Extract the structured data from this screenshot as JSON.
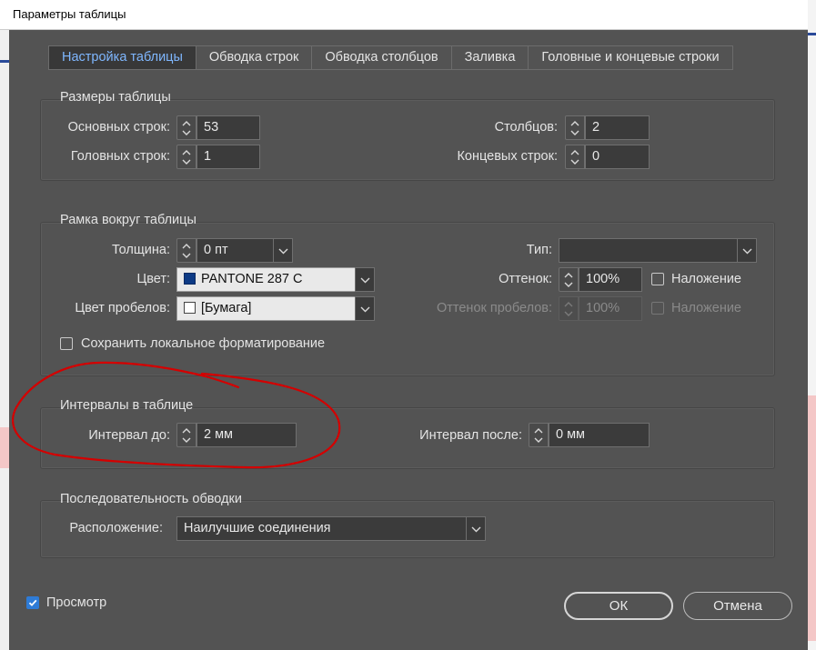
{
  "window": {
    "title": "Параметры таблицы"
  },
  "tabs": [
    {
      "label": "Настройка таблицы",
      "active": true
    },
    {
      "label": "Обводка строк"
    },
    {
      "label": "Обводка столбцов"
    },
    {
      "label": "Заливка"
    },
    {
      "label": "Головные и концевые строки"
    }
  ],
  "table_size": {
    "title": "Размеры таблицы",
    "body_rows_label": "Основных строк:",
    "body_rows": "53",
    "columns_label": "Столбцов:",
    "columns": "2",
    "header_rows_label": "Головных строк:",
    "header_rows": "1",
    "footer_rows_label": "Концевых строк:",
    "footer_rows": "0"
  },
  "border": {
    "title": "Рамка вокруг таблицы",
    "weight_label": "Толщина:",
    "weight": "0 пт",
    "type_label": "Тип:",
    "type": "",
    "color_label": "Цвет:",
    "color": "PANTONE 287 C",
    "color_swatch": "#0d3a85",
    "tint_label": "Оттенок:",
    "tint": "100%",
    "overprint_label": "Наложение",
    "gap_color_label": "Цвет пробелов:",
    "gap_color": "[Бумага]",
    "gap_swatch": "#ffffff",
    "gap_tint_label": "Оттенок пробелов:",
    "gap_tint": "100%",
    "gap_overprint_label": "Наложение",
    "preserve_label": "Сохранить локальное форматирование"
  },
  "spacing": {
    "title": "Интервалы в таблице",
    "before_label": "Интервал до:",
    "before": "2 мм",
    "after_label": "Интервал после:",
    "after": "0 мм"
  },
  "stroke_order": {
    "title": "Последовательность обводки",
    "arrangement_label": "Расположение:",
    "arrangement": "Наилучшие соединения"
  },
  "footer": {
    "preview_label": "Просмотр",
    "preview_checked": true,
    "ok_label": "ОК",
    "cancel_label": "Отмена"
  },
  "colors": {
    "dialog_bg": "#535353",
    "active_tab_text": "#7fb7ff",
    "annotation": "#d40000",
    "checkbox_on": "#2e7bd6"
  }
}
